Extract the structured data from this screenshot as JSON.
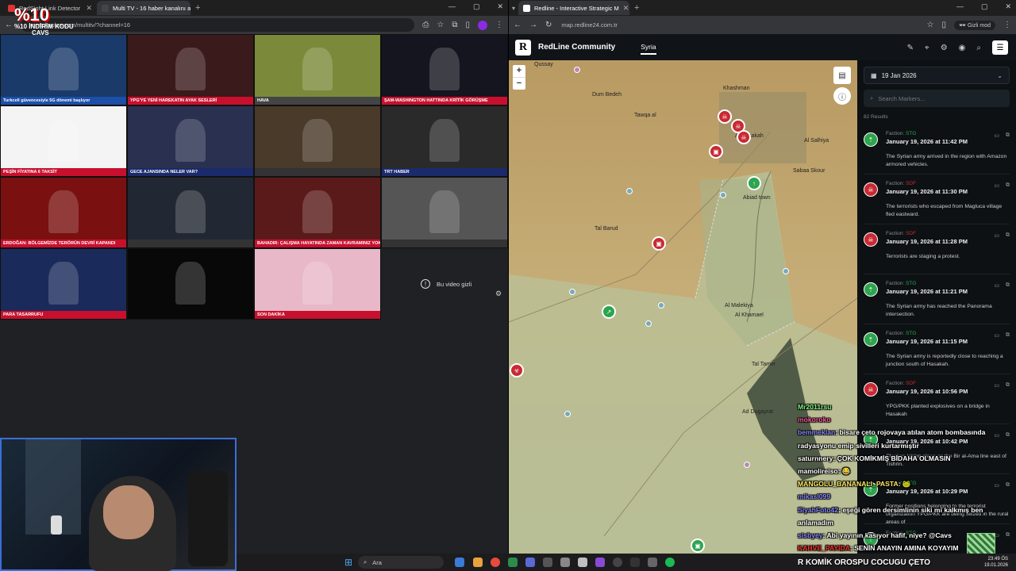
{
  "left_window": {
    "tabs": [
      {
        "label": "RedSight Link Detector"
      },
      {
        "label": "Multi TV - 16 haber kanalını ay"
      }
    ],
    "url": "mertskaplan.com/multitv/?channel=16",
    "hidden_video_text": "Bu video gizli"
  },
  "overlay_logo": {
    "line1": "%10",
    "line2": "%10 İNDİRİM KODU",
    "line3": "CAVS"
  },
  "tv_cells": [
    {
      "ticker": "Turkcell güvencesiyle 5G dönemi başlıyor",
      "bg": "#1a3a6a",
      "bar": "#1b4fa8"
    },
    {
      "ticker": "YPG'YE YENİ HAREKATIN AYAK SESLERİ",
      "bg": "#3a1a1a",
      "bar": "#c8102e"
    },
    {
      "ticker": "HAVA",
      "bg": "#7a8a3a",
      "bar": "#444"
    },
    {
      "ticker": "ŞAM-WASHINGTON HATTINDA KRİTİK GÖRÜŞME",
      "bg": "#151520",
      "bar": "#c8102e"
    },
    {
      "ticker": "PEŞİN FİYATINA 6 TAKSİT",
      "bg": "#f4f4f4",
      "bar": "#c8102e"
    },
    {
      "ticker": "GECE AJANSINDA NELER VAR?",
      "bg": "#2a3050",
      "bar": "#1b2a6a"
    },
    {
      "ticker": "",
      "bg": "#4a3a2a",
      "bar": "#333"
    },
    {
      "ticker": "TRT HABER",
      "bg": "#2a2a2a",
      "bar": "#1b2a6a"
    },
    {
      "ticker": "ERDOĞAN: BÖLGEMİZDE TERÖRÜN DEVRİ KAPANDI",
      "bg": "#7a1010",
      "bar": "#c8102e"
    },
    {
      "ticker": "",
      "bg": "#222833",
      "bar": "#333"
    },
    {
      "ticker": "BAHADIR: ÇALIŞMA HAYATINDA ZAMAN KAVRAMINIZ YOK",
      "bg": "#5a1a1a",
      "bar": "#c8102e"
    },
    {
      "ticker": "",
      "bg": "#555",
      "bar": "#333"
    },
    {
      "ticker": "PARA TASARRUFU",
      "bg": "#1a2a5a",
      "bar": "#c8102e"
    },
    {
      "ticker": "",
      "bg": "#080808",
      "bar": "#080808"
    },
    {
      "ticker": "SON DAKİKA",
      "bg": "#e8b8c8",
      "bar": "#c8102e"
    }
  ],
  "right_window": {
    "tabs": [
      {
        "label": "Redline - Interactive Strategic M"
      }
    ],
    "url": "map.redline24.com.tr",
    "incognito": "Gizli mod"
  },
  "app": {
    "brand": "RedLine Community",
    "logo_letter": "R",
    "region": "Syria",
    "date": "19 Jan 2026",
    "search_placeholder": "Search Markers...",
    "results": "82 Results"
  },
  "map_places": [
    "Dum Bedeh",
    "Tawqa al",
    "Khashman",
    "Tal Barud",
    "Al Hasakah",
    "Abiad town",
    "Sabaa Skour",
    "Al Malekiya",
    "Al Khamael",
    "Tal Tamer",
    "Ad Dugayrat",
    "Al Salhiya",
    "Qussay"
  ],
  "entries": [
    {
      "faction": "STG",
      "faction_color": "#2ea44f",
      "time": "January 19, 2026 at 11:42 PM",
      "desc": "The Syrian army arrived in the region with Amazon armored vehicles."
    },
    {
      "faction": "SDF",
      "faction_color": "#c82a33",
      "time": "January 19, 2026 at 11:30 PM",
      "desc": "The terrorists who escaped from Magluca village fled eastward."
    },
    {
      "faction": "SDF",
      "faction_color": "#c82a33",
      "time": "January 19, 2026 at 11:28 PM",
      "desc": "Terrorists are staging a protest."
    },
    {
      "faction": "STG",
      "faction_color": "#2ea44f",
      "time": "January 19, 2026 at 11:21 PM",
      "desc": "The Syrian army has reached the Panorama intersection."
    },
    {
      "faction": "STG",
      "faction_color": "#2ea44f",
      "time": "January 19, 2026 at 11:15 PM",
      "desc": "The Syrian army is reportedly close to reaching a junction south of Hasakah."
    },
    {
      "faction": "SDF",
      "faction_color": "#c82a33",
      "time": "January 19, 2026 at 10:56 PM",
      "desc": "YPG/PKK planted explosives on a bridge in Hasakah"
    },
    {
      "faction": "STG",
      "faction_color": "#2ea44f",
      "time": "January 19, 2026 at 10:42 PM",
      "desc": "Clashes taking place on the Bir al-Ama line east of Tishrin."
    },
    {
      "faction": "STG",
      "faction_color": "#2ea44f",
      "time": "January 19, 2026 at 10:29 PM",
      "desc": "Former positions belonging to the terrorist organization YPG/PKK are being seized in the rural areas of"
    },
    {
      "faction": "STG",
      "faction_color": "#2ea44f",
      "time": "",
      "desc": ""
    }
  ],
  "chat": [
    {
      "user": "Mr2011rsu",
      "msg": "",
      "color": "#7cf07c"
    },
    {
      "user": "mokoroko",
      "msg": "",
      "color": "#ff5aa0"
    },
    {
      "user": "bemmeklan",
      "msg": ": bisare çeto rojovaya atılan atom bombasında",
      "color": "#8888ff"
    },
    {
      "user": "",
      "msg": "radyasyonu emip sivilleri kurtarmıştır",
      "color": "#fff"
    },
    {
      "user": "saturnnery",
      "msg": ": ÇOK KOMİKMİŞ BİDAHA OLMASIN",
      "color": "#ffffff"
    },
    {
      "user": "mamolireiso",
      "msg": ": 😂",
      "color": "#ffffff"
    },
    {
      "user": "MANGOLU_BANANALI_PASTA",
      "msg": ": 🐸",
      "color": "#ffea60"
    },
    {
      "user": "mikasl099",
      "msg": "",
      "color": "#8888ff"
    },
    {
      "user": "SiyahFoto42",
      "msg": ": eşeği gören dersimlinin siki mi kalkmış ben",
      "color": "#8888ff"
    },
    {
      "user": "",
      "msg": "anlamadım",
      "color": "#fff"
    },
    {
      "user": "sisbyey",
      "msg": ": Abi yayının kasıyor hafif, niye? @Cavs",
      "color": "#8888ff"
    },
    {
      "user": "KAHVE_PAYIDA",
      "msg": ": SENİN ANAYIN AMINA KOYAYIM",
      "color": "#ff3030"
    }
  ],
  "bottom_ticker": "R KOMİK OROSPU COCUGU ÇETO",
  "taskbar": {
    "search": "Ara",
    "time": "23:49 ÖS",
    "date": "19.01.2026"
  }
}
